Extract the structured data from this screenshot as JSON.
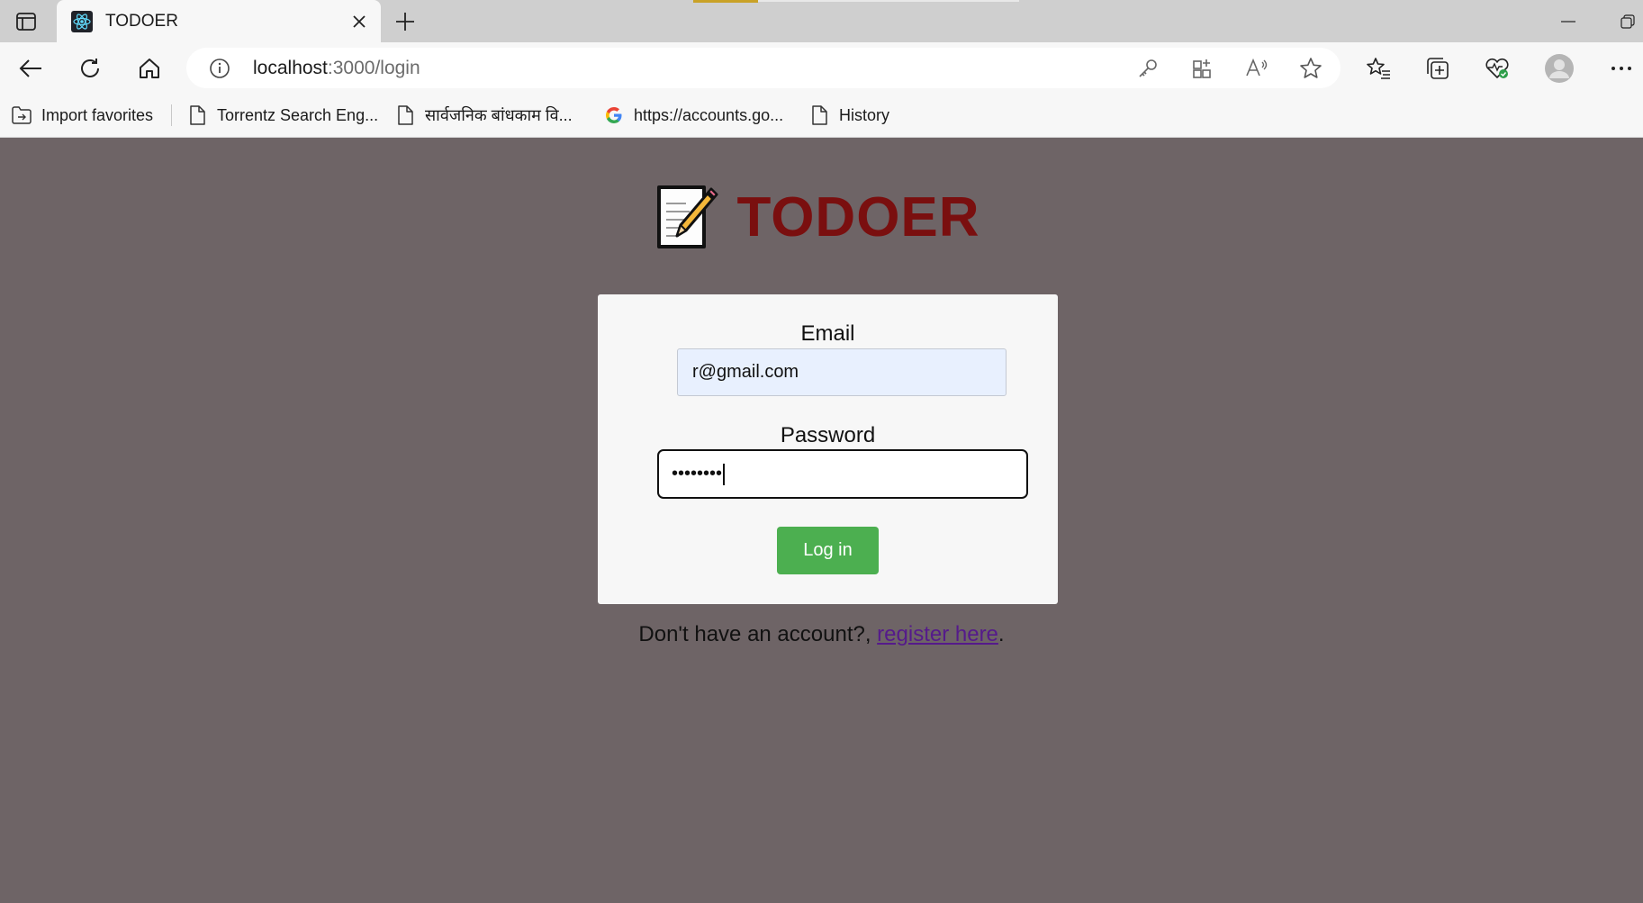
{
  "browser": {
    "tab": {
      "title": "TODOER",
      "favicon": "react-icon"
    },
    "address": {
      "host": "localhost",
      "path": ":3000/login"
    },
    "favorites": [
      {
        "label": "Import favorites",
        "icon": "import-folder-icon"
      },
      {
        "label": "Torrentz Search Eng...",
        "icon": "page-icon"
      },
      {
        "label": "सार्वजनिक बांधकाम वि...",
        "icon": "page-icon"
      },
      {
        "label": "https://accounts.go...",
        "icon": "google-icon"
      },
      {
        "label": "History",
        "icon": "page-icon"
      }
    ]
  },
  "app": {
    "title": "TODOER",
    "logo": "memo-icon",
    "title_color": "#7a0f0f",
    "background": "#6e6466"
  },
  "login": {
    "email_label": "Email",
    "email_value": "r@gmail.com",
    "password_label": "Password",
    "password_masked": "••••••••",
    "button_label": "Log in",
    "button_color": "#4caf50",
    "register_prefix": "Don't have an account?, ",
    "register_link": "register here",
    "register_suffix": "."
  }
}
